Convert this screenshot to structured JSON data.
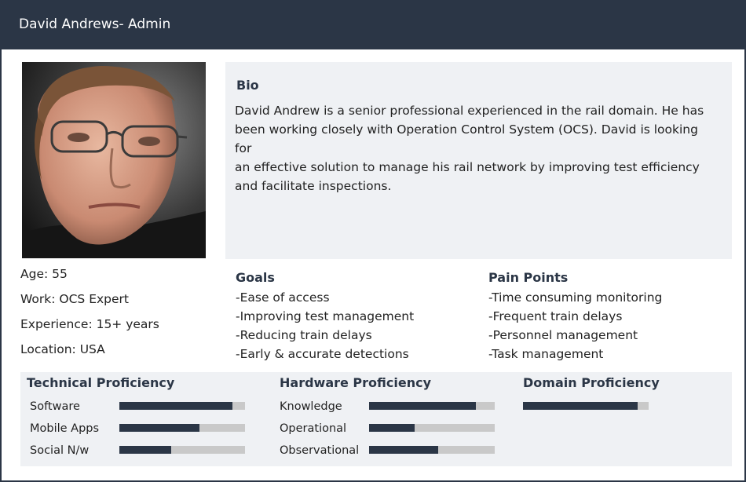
{
  "header": {
    "title": "David Andrews- Admin"
  },
  "bio": {
    "title": "Bio",
    "line1": "David Andrew is a senior professional experienced in the rail domain. He has",
    "line2": "been working closely with Operation Control System (OCS). David is looking for",
    "line3": "an effective solution to manage his rail network by improving test efficiency",
    "line4": "and facilitate inspections."
  },
  "facts": {
    "age": "Age: 55",
    "work": "Work: OCS Expert",
    "experience": "Experience: 15+ years",
    "location": "Location: USA"
  },
  "goals": {
    "title": "Goals",
    "items": [
      "-Ease of access",
      "-Improving test management",
      "-Reducing train delays",
      "-Early & accurate detections"
    ]
  },
  "pain_points": {
    "title": "Pain Points",
    "items": [
      "-Time consuming monitoring",
      "-Frequent train delays",
      "-Personnel management",
      "-Task management"
    ]
  },
  "technical": {
    "title": "Technical Proficiency",
    "items": [
      {
        "label": "Software",
        "level": 0.9
      },
      {
        "label": "Mobile Apps",
        "level": 0.64
      },
      {
        "label": "Social N/w",
        "level": 0.41
      }
    ]
  },
  "hardware": {
    "title": "Hardware Proficiency",
    "items": [
      {
        "label": "Knowledge",
        "level": 0.85
      },
      {
        "label": "Operational",
        "level": 0.36
      },
      {
        "label": "Observational",
        "level": 0.55
      }
    ]
  },
  "domain": {
    "title": "Domain Proficiency",
    "level": 0.91
  },
  "colors": {
    "accent": "#2b3646",
    "panel": "#eff1f4",
    "bar_track": "#c9c9c9"
  }
}
